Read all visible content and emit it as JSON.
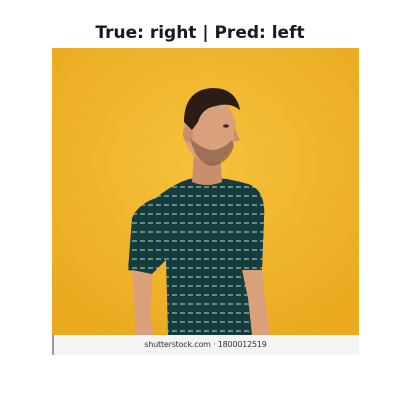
{
  "figure": {
    "title": "True: right | Pred: left"
  },
  "photo": {
    "subject": "man-in-striped-tshirt",
    "background_color": "#f2b42b",
    "shirt_color": "#173c3f",
    "stripe_color": "#5f8e86",
    "skin_color": "#d9a07c",
    "hair_color": "#2b1d15",
    "footer_color": "#f4f4f4",
    "stock_caption": "shutterstock.com · 1800012519"
  }
}
